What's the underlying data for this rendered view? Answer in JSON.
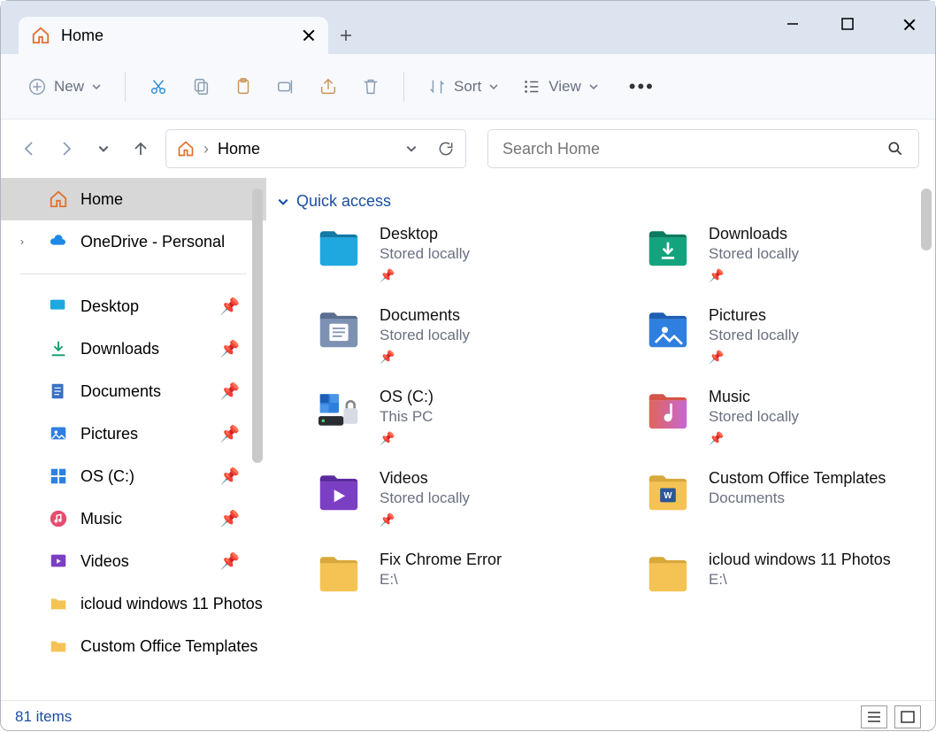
{
  "titlebar": {
    "tab_label": "Home"
  },
  "toolbar": {
    "new_label": "New",
    "sort_label": "Sort",
    "view_label": "View"
  },
  "address": {
    "location": "Home"
  },
  "search": {
    "placeholder": "Search Home"
  },
  "sidebar": {
    "home": "Home",
    "onedrive": "OneDrive - Personal",
    "items": [
      {
        "label": "Desktop",
        "icon": "desktop"
      },
      {
        "label": "Downloads",
        "icon": "downloads"
      },
      {
        "label": "Documents",
        "icon": "documents"
      },
      {
        "label": "Pictures",
        "icon": "pictures"
      },
      {
        "label": "OS (C:)",
        "icon": "drive"
      },
      {
        "label": "Music",
        "icon": "music"
      },
      {
        "label": "Videos",
        "icon": "videos"
      },
      {
        "label": "icloud windows 11 Photos",
        "icon": "folder"
      },
      {
        "label": "Custom Office Templates",
        "icon": "folder"
      }
    ]
  },
  "section": {
    "title": "Quick access"
  },
  "quickaccess": [
    {
      "name": "Desktop",
      "sub": "Stored locally",
      "icon": "desktop-folder",
      "pin": true
    },
    {
      "name": "Downloads",
      "sub": "Stored locally",
      "icon": "downloads-folder",
      "pin": true
    },
    {
      "name": "Documents",
      "sub": "Stored locally",
      "icon": "documents-folder",
      "pin": true
    },
    {
      "name": "Pictures",
      "sub": "Stored locally",
      "icon": "pictures-folder",
      "pin": true
    },
    {
      "name": "OS (C:)",
      "sub": "This PC",
      "icon": "drive-lock",
      "pin": true
    },
    {
      "name": "Music",
      "sub": "Stored locally",
      "icon": "music-folder",
      "pin": true
    },
    {
      "name": "Videos",
      "sub": "Stored locally",
      "icon": "videos-folder",
      "pin": true
    },
    {
      "name": "Custom Office Templates",
      "sub": "Documents",
      "icon": "templates-folder",
      "pin": false
    },
    {
      "name": "Fix Chrome Error",
      "sub": "E:\\",
      "icon": "folder",
      "pin": false
    },
    {
      "name": "icloud windows 11 Photos",
      "sub": "E:\\",
      "icon": "folder",
      "pin": false
    }
  ],
  "statusbar": {
    "count": "81 items"
  }
}
